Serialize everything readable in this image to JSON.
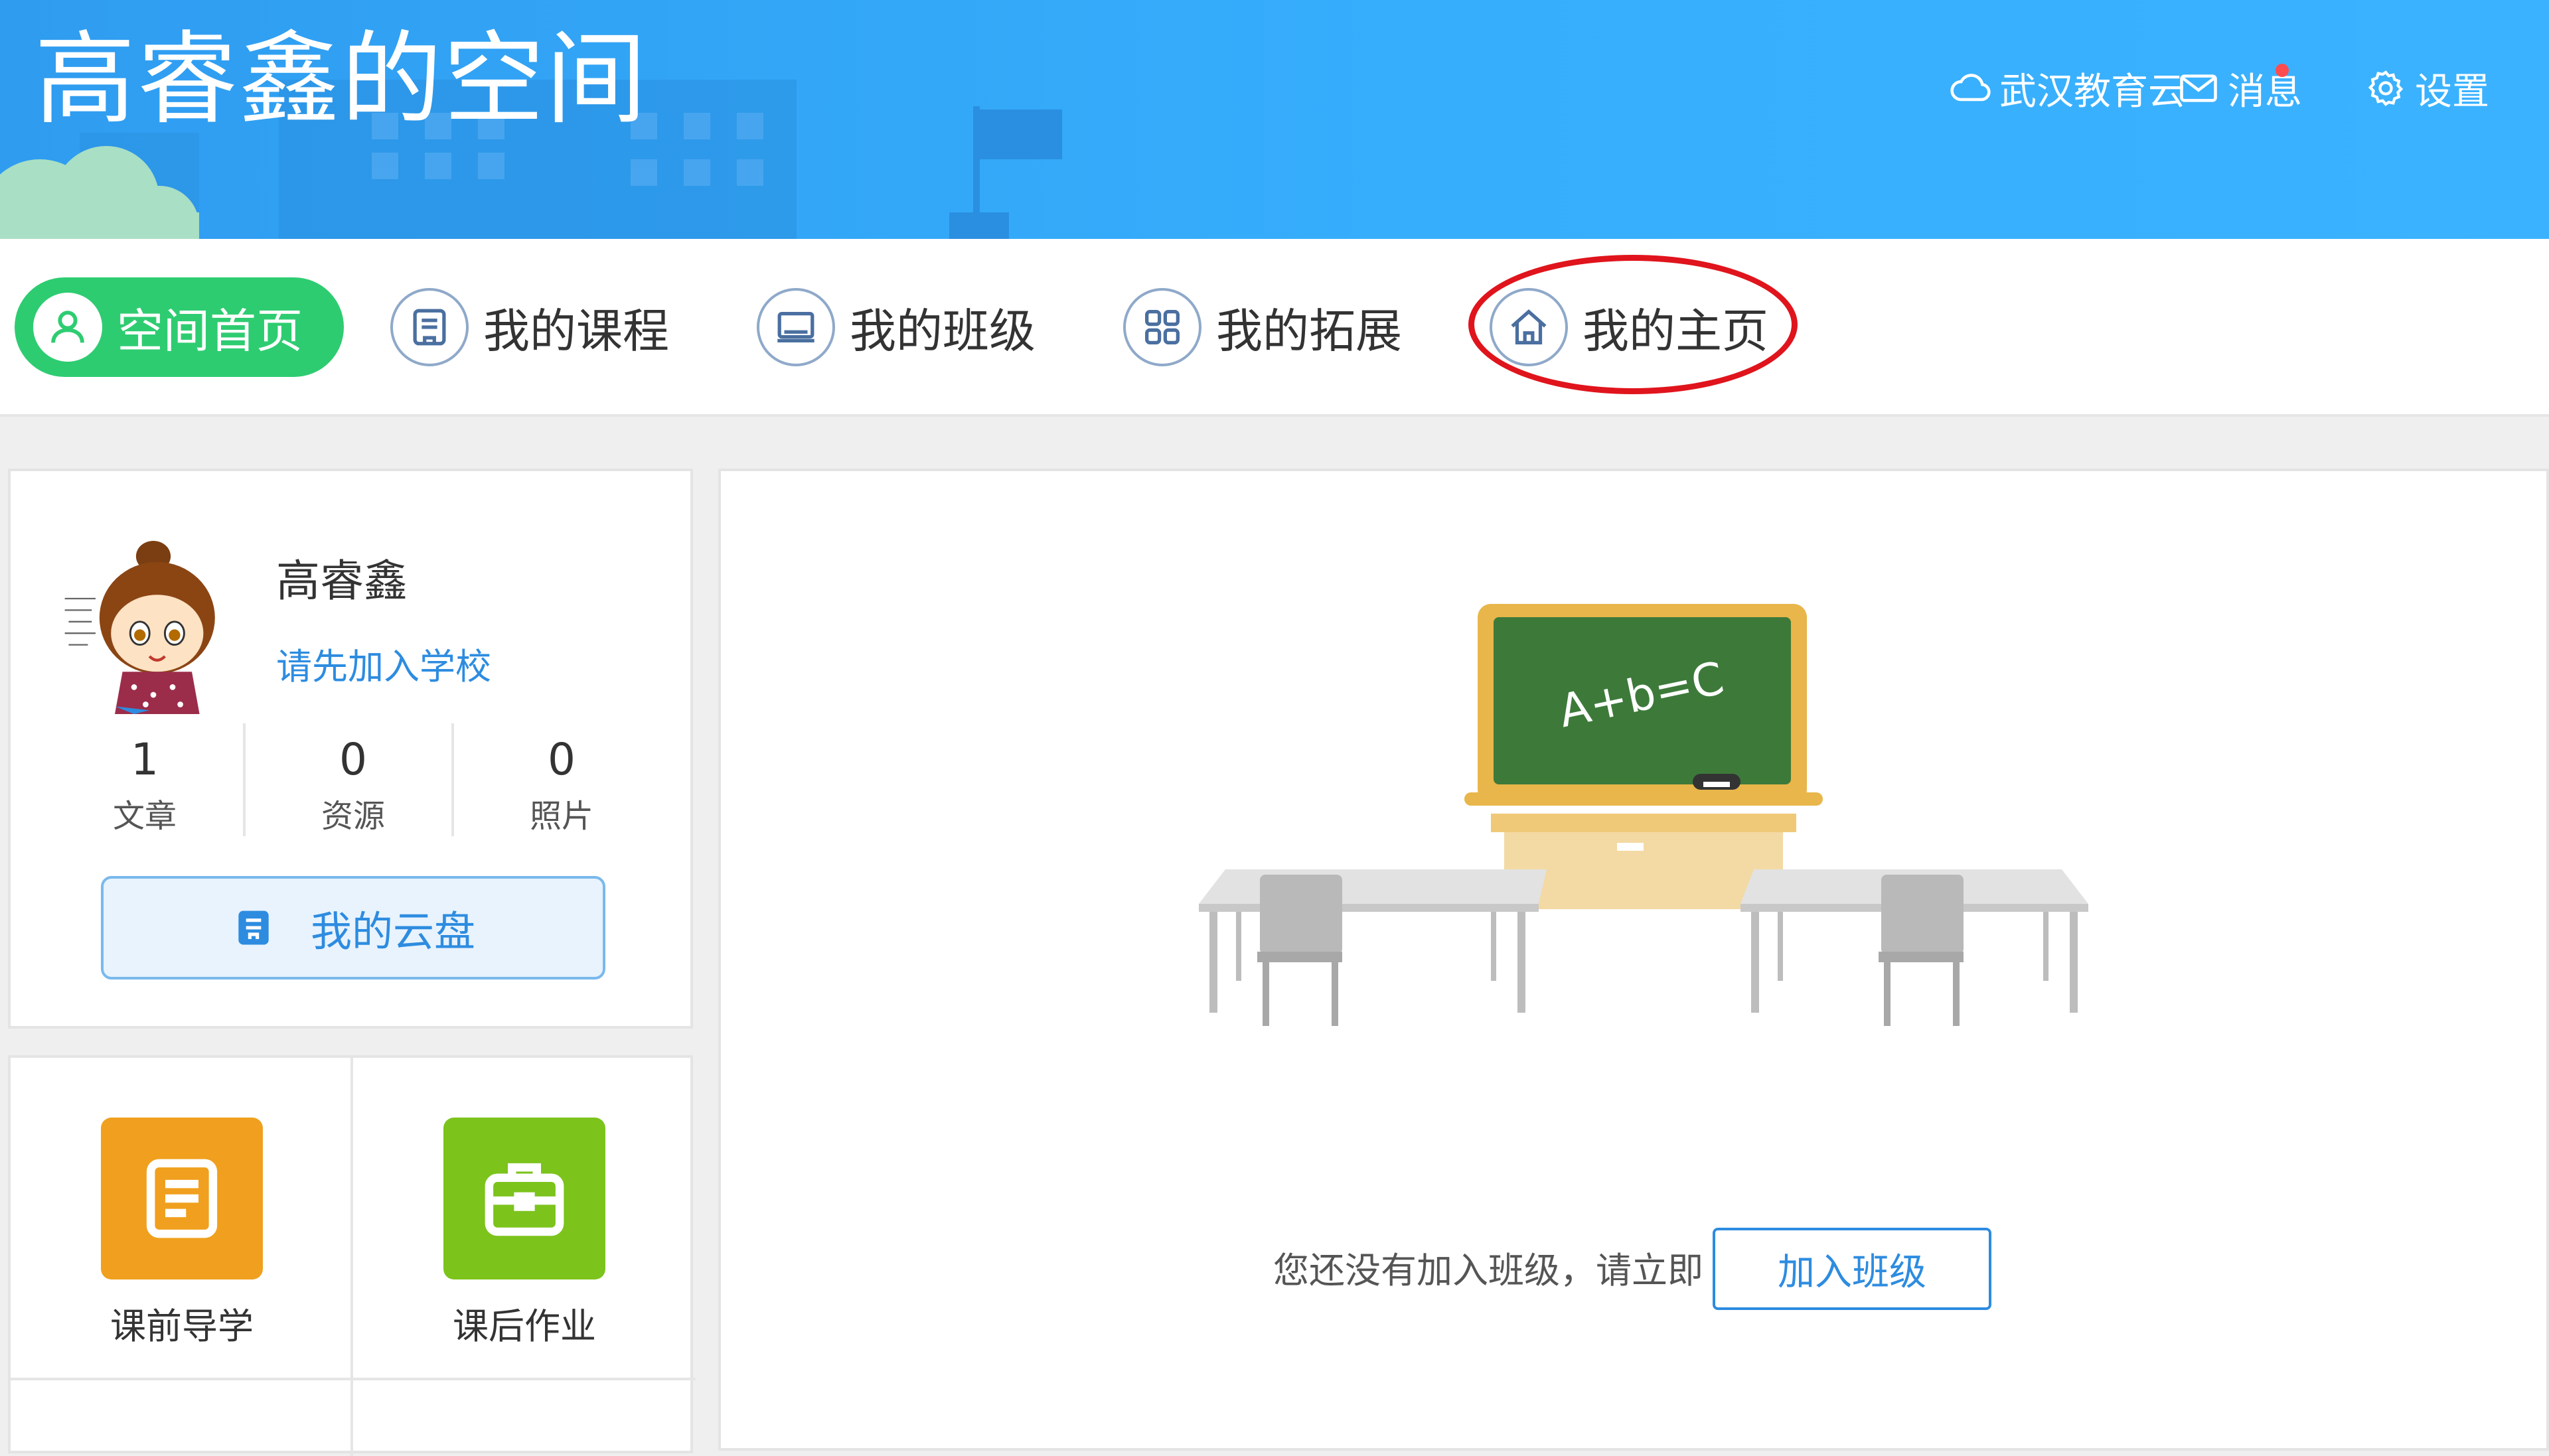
{
  "header": {
    "space_title": "高睿鑫的空间",
    "links": {
      "cloud": "武汉教育云",
      "messages": "消息",
      "settings": "设置"
    }
  },
  "nav": {
    "items": [
      {
        "label": "空间首页",
        "icon": "user-icon",
        "active": true
      },
      {
        "label": "我的课程",
        "icon": "course-icon"
      },
      {
        "label": "我的班级",
        "icon": "monitor-icon"
      },
      {
        "label": "我的拓展",
        "icon": "grid-icon"
      },
      {
        "label": "我的主页",
        "icon": "home-icon",
        "highlighted": true
      }
    ]
  },
  "profile": {
    "name": "高睿鑫",
    "join_school": "请先加入学校",
    "stats": [
      {
        "value": "1",
        "label": "文章"
      },
      {
        "value": "0",
        "label": "资源"
      },
      {
        "value": "0",
        "label": "照片"
      }
    ],
    "cloud_disk": "我的云盘"
  },
  "apps": [
    {
      "label": "课前导学",
      "color": "#f0a01e"
    },
    {
      "label": "课后作业",
      "color": "#7cc31c"
    }
  ],
  "main": {
    "chalkboard_text": "A+b=C",
    "empty_message": "您还没有加入班级，请立即",
    "join_class_button": "加入班级"
  },
  "colors": {
    "banner": "#36aefc",
    "active_nav": "#2ecc71",
    "link_blue": "#2d8ce0",
    "highlight_ring": "#e0141c",
    "notification_dot": "#ff4d4f"
  }
}
